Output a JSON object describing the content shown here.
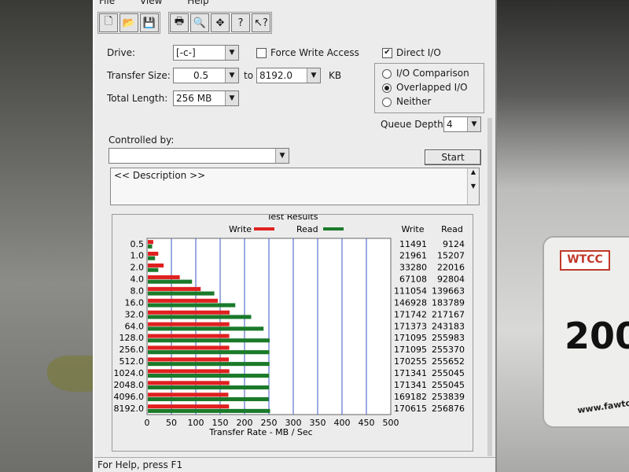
{
  "window": {
    "menu": [
      "File",
      "View",
      "Help"
    ],
    "toolbar_icons": [
      "new-icon",
      "open-icon",
      "save-icon",
      "print-icon",
      "print-preview-icon",
      "move-icon",
      "help-icon",
      "context-help-icon"
    ]
  },
  "settings": {
    "drive_label": "Drive:",
    "drive_value": "[-c-]",
    "force_write_label": "Force Write Access",
    "force_write_checked": false,
    "direct_io_label": "Direct I/O",
    "direct_io_checked": true,
    "transfer_size_label": "Transfer Size:",
    "transfer_from": "0.5",
    "to_label": "to",
    "transfer_to": "8192.0",
    "kb_label": "KB",
    "total_length_label": "Total Length:",
    "total_length": "256 MB",
    "io_comparison": "I/O Comparison",
    "overlapped_io": "Overlapped I/O",
    "neither": "Neither",
    "selected_mode": "Overlapped I/O",
    "queue_depth_label": "Queue Depth:",
    "queue_depth": "4",
    "controlled_by_label": "Controlled by:",
    "controlled_by_value": "",
    "start_button": "Start",
    "description": "<< Description >>"
  },
  "status": {
    "text": "For Help, press F1"
  },
  "chart_data": {
    "type": "bar",
    "title": "Test Results",
    "xlabel": "Transfer Rate - MB / Sec",
    "ylabel": "",
    "xlim": [
      0,
      500
    ],
    "x_ticks": [
      "0",
      "50",
      "100",
      "150",
      "200",
      "250",
      "300",
      "350",
      "400",
      "450",
      "500"
    ],
    "categories": [
      "0.5",
      "1.0",
      "2.0",
      "4.0",
      "8.0",
      "16.0",
      "32.0",
      "64.0",
      "128.0",
      "256.0",
      "512.0",
      "1024.0",
      "2048.0",
      "4096.0",
      "8192.0"
    ],
    "series": [
      {
        "name": "Write",
        "color": "#e02020",
        "values": [
          11491,
          21961,
          33280,
          67108,
          111054,
          146928,
          171742,
          171373,
          171095,
          171095,
          170255,
          171341,
          171341,
          169182,
          170615
        ]
      },
      {
        "name": "Read",
        "color": "#1a7a2a",
        "values": [
          9124,
          15207,
          22016,
          92804,
          139663,
          183789,
          217167,
          243183,
          255983,
          255370,
          255652,
          255045,
          255045,
          253839,
          256876
        ]
      }
    ],
    "column_headers": [
      "Write",
      "Read"
    ],
    "legend": "top",
    "grid": true
  }
}
